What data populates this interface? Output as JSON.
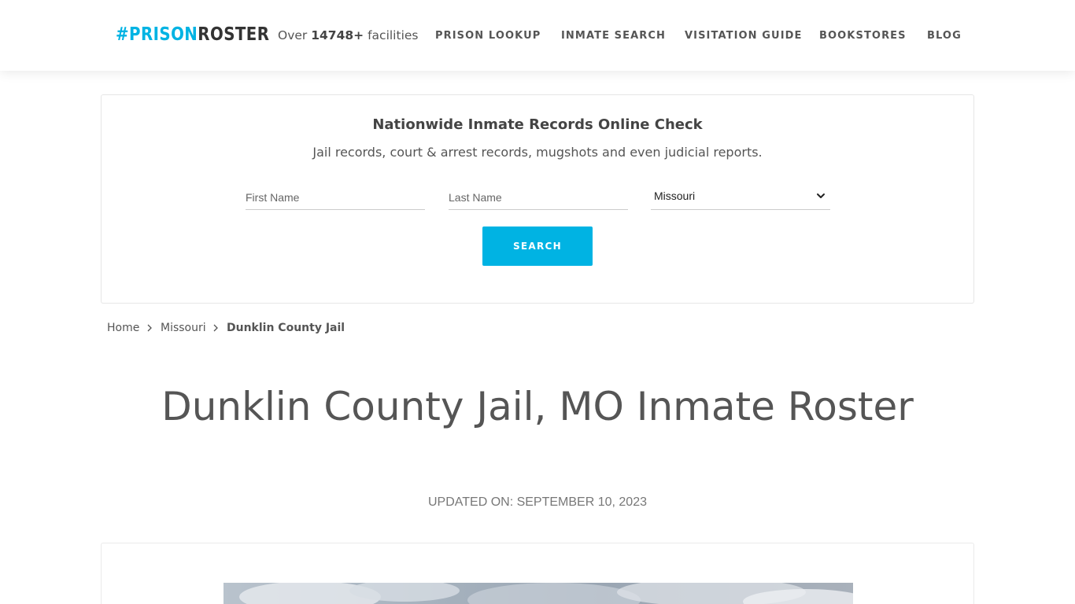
{
  "header": {
    "logo": {
      "hash": "#",
      "prison": "PRISON",
      "roster": "ROSTER"
    },
    "facilities": {
      "prefix": "Over",
      "count": "14748+",
      "suffix": "facilities"
    },
    "nav": [
      "PRISON LOOKUP",
      "INMATE SEARCH",
      "VISITATION GUIDE",
      "BOOKSTORES",
      "BLOG"
    ]
  },
  "search": {
    "title": "Nationwide Inmate Records Online Check",
    "subtitle": "Jail records, court & arrest records, mugshots and even judicial reports.",
    "first_name_placeholder": "First Name",
    "last_name_placeholder": "Last Name",
    "state_selected": "Missouri",
    "button_label": "SEARCH"
  },
  "breadcrumb": {
    "home": "Home",
    "state": "Missouri",
    "current": "Dunklin County Jail"
  },
  "page": {
    "title": "Dunklin County Jail, MO Inmate Roster",
    "updated": "UPDATED ON: SEPTEMBER 10, 2023"
  },
  "colors": {
    "accent": "#00b3e3",
    "text": "#555555",
    "logo_dark": "#333333"
  }
}
